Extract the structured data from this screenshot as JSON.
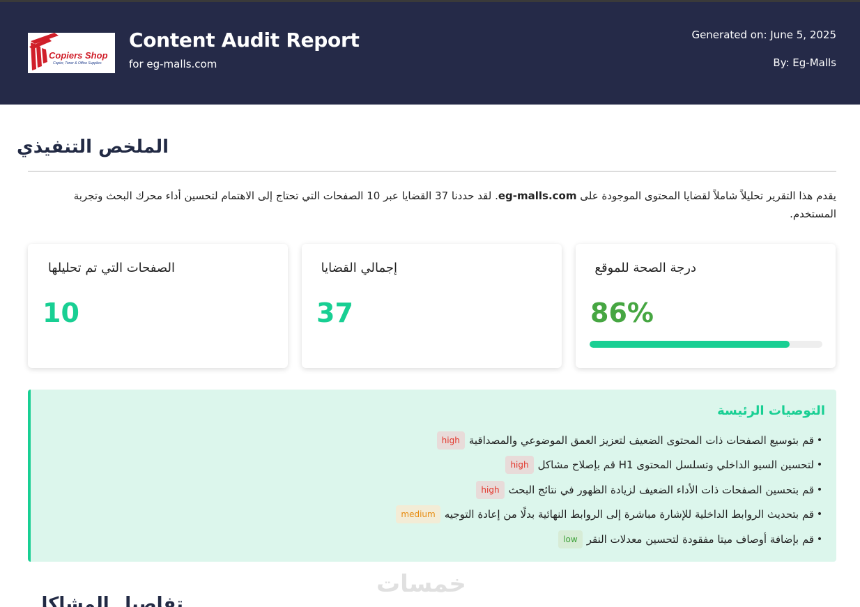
{
  "header": {
    "logo_text": "Copiers Shop",
    "logo_sub": "Copier, Toner & Office Supplies",
    "title": "Content Audit Report",
    "subtitle": "for eg-malls.com",
    "generated": "Generated on: June 5, 2025",
    "by": "By: Eg-Malls",
    "colors": {
      "bg": "#252a48",
      "accent": "#18cf93"
    }
  },
  "summary": {
    "title": "الملخص التنفيذي",
    "text_before": "يقدم هذا التقرير تحليلاً شاملاً لقضايا المحتوى الموجودة على ",
    "domain": "eg-malls.com",
    "text_after": ". لقد حددنا 37 القضايا عبر 10 الصفحات التي تحتاج إلى الاهتمام لتحسين أداء محرك البحث وتجربة المستخدم."
  },
  "cards": [
    {
      "label": "الصفحات التي تم تحليلها",
      "value": "10"
    },
    {
      "label": "إجمالي القضايا",
      "value": "37"
    },
    {
      "label": "درجة الصحة للموقع",
      "value": "86%",
      "progress": 0.86
    }
  ],
  "recommendations": {
    "title": "التوصيات الرئيسة",
    "items": [
      {
        "text": "قم بتوسيع الصفحات ذات المحتوى الضعيف لتعزيز العمق الموضوعي والمصداقية",
        "priority": "high"
      },
      {
        "text": "لتحسين السيو الداخلي وتسلسل المحتوى H1 قم بإصلاح مشاكل",
        "priority": "high"
      },
      {
        "text": "قم بتحسين الصفحات ذات الأداء الضعيف لزيادة الظهور في نتائج البحث",
        "priority": "high"
      },
      {
        "text": "قم بتحديث الروابط الداخلية للإشارة مباشرة إلى الروابط النهائية بدلًا من إعادة التوجيه",
        "priority": "medium"
      },
      {
        "text": "قم بإضافة أوصاف ميتا مفقودة لتحسين معدلات النقر",
        "priority": "low"
      }
    ]
  },
  "watermark": "خمسات",
  "next_section_title": "تفاصيل المشاكل"
}
